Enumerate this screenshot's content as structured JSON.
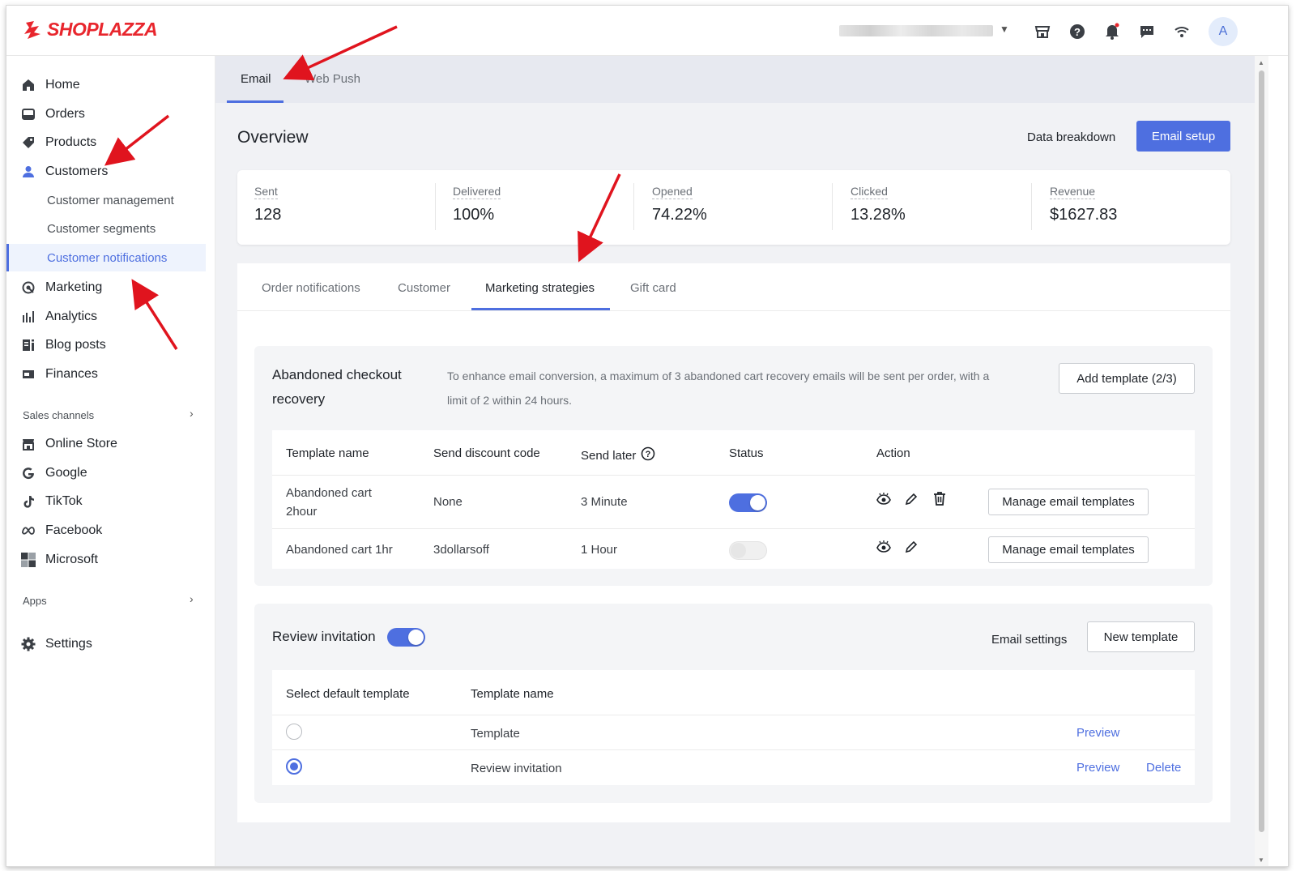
{
  "brand": {
    "name": "SHOPLAZZA",
    "color": "#e8262d",
    "accent": "#4e6fe0"
  },
  "topbar": {
    "icons": [
      "store-icon",
      "help-icon",
      "bell-icon",
      "chat-icon",
      "wifi-icon"
    ],
    "avatar_letter": "A"
  },
  "sidebar": {
    "items": [
      {
        "label": "Home",
        "icon": "home-icon"
      },
      {
        "label": "Orders",
        "icon": "orders-icon"
      },
      {
        "label": "Products",
        "icon": "tag-icon"
      },
      {
        "label": "Customers",
        "icon": "person-icon"
      },
      {
        "label": "Marketing",
        "icon": "marketing-icon"
      },
      {
        "label": "Analytics",
        "icon": "analytics-icon"
      },
      {
        "label": "Blog posts",
        "icon": "blog-icon"
      },
      {
        "label": "Finances",
        "icon": "finances-icon"
      }
    ],
    "customer_sub": [
      "Customer management",
      "Customer segments",
      "Customer notifications"
    ],
    "sales_channels_label": "Sales channels",
    "channels": [
      {
        "label": "Online Store",
        "icon": "store-icon"
      },
      {
        "label": "Google",
        "icon": "google-icon"
      },
      {
        "label": "TikTok",
        "icon": "tiktok-icon"
      },
      {
        "label": "Facebook",
        "icon": "meta-icon"
      },
      {
        "label": "Microsoft",
        "icon": "microsoft-icon"
      }
    ],
    "apps_label": "Apps",
    "settings_label": "Settings"
  },
  "top_tabs": [
    "Email",
    "Web Push"
  ],
  "overview": {
    "title": "Overview",
    "data_breakdown": "Data breakdown",
    "email_setup": "Email setup",
    "stats": [
      {
        "label": "Sent",
        "value": "128"
      },
      {
        "label": "Delivered",
        "value": "100%"
      },
      {
        "label": "Opened",
        "value": "74.22%"
      },
      {
        "label": "Clicked",
        "value": "13.28%"
      },
      {
        "label": "Revenue",
        "value": "$1627.83"
      }
    ]
  },
  "panel_tabs": [
    "Order notifications",
    "Customer",
    "Marketing strategies",
    "Gift card"
  ],
  "abandoned": {
    "title_line1": "Abandoned checkout",
    "title_line2": "recovery",
    "desc_line1": "To enhance email conversion, a maximum of 3 abandoned cart recovery emails will be sent per order, with a",
    "desc_line2": "limit of 2 within 24 hours.",
    "add_template": "Add template (2/3)",
    "columns": [
      "Template name",
      "Send discount code",
      "Send later",
      "Status",
      "Action"
    ],
    "rows": [
      {
        "name_line1": "Abandoned cart",
        "name_line2": "2hour",
        "discount": "None",
        "later": "3 Minute",
        "status": true,
        "manage": "Manage email templates"
      },
      {
        "name_line1": "Abandoned cart 1hr",
        "name_line2": "",
        "discount": "3dollarsoff",
        "later": "1 Hour",
        "status": false,
        "manage": "Manage email templates"
      }
    ]
  },
  "review": {
    "title": "Review invitation",
    "enabled": true,
    "email_settings": "Email settings",
    "new_template": "New template",
    "columns": [
      "Select default template",
      "Template name"
    ],
    "rows": [
      {
        "name": "Template",
        "selected": false,
        "preview": "Preview",
        "delete": ""
      },
      {
        "name": "Review invitation",
        "selected": true,
        "preview": "Preview",
        "delete": "Delete"
      }
    ]
  }
}
